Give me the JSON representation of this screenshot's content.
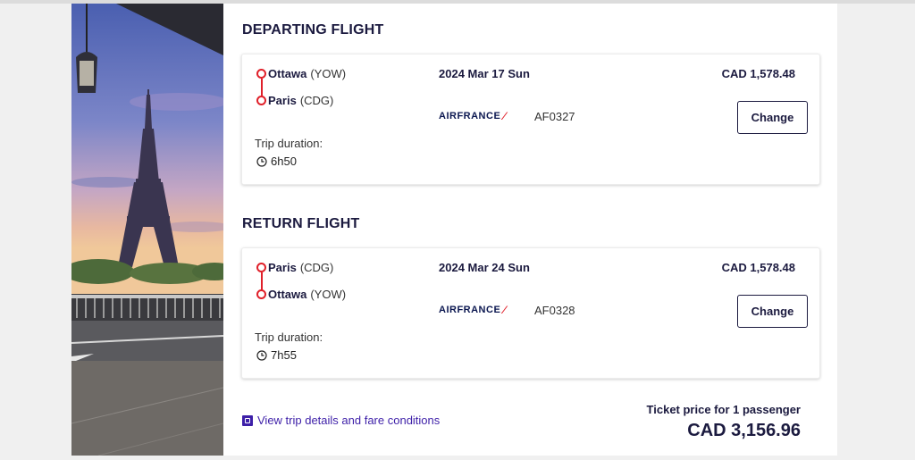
{
  "departing": {
    "title": "DEPARTING FLIGHT",
    "origin_city": "Ottawa",
    "origin_code": "(YOW)",
    "dest_city": "Paris",
    "dest_code": "(CDG)",
    "date": "2024 Mar 17 Sun",
    "airline": "AIRFRANCE",
    "flight_number": "AF0327",
    "price": "CAD 1,578.48",
    "change_label": "Change",
    "duration_label": "Trip duration:",
    "duration": "6h50"
  },
  "return": {
    "title": "RETURN FLIGHT",
    "origin_city": "Paris",
    "origin_code": "(CDG)",
    "dest_city": "Ottawa",
    "dest_code": "(YOW)",
    "date": "2024 Mar 24 Sun",
    "airline": "AIRFRANCE",
    "flight_number": "AF0328",
    "price": "CAD 1,578.48",
    "change_label": "Change",
    "duration_label": "Trip duration:",
    "duration": "7h55"
  },
  "footer": {
    "details_link": "View trip details and fare conditions",
    "ticket_label": "Ticket price for 1 passenger",
    "ticket_total": "CAD 3,156.96"
  },
  "colors": {
    "brand_navy": "#1b1a3f",
    "route_red": "#e0202a",
    "link_purple": "#3d1fa8"
  }
}
